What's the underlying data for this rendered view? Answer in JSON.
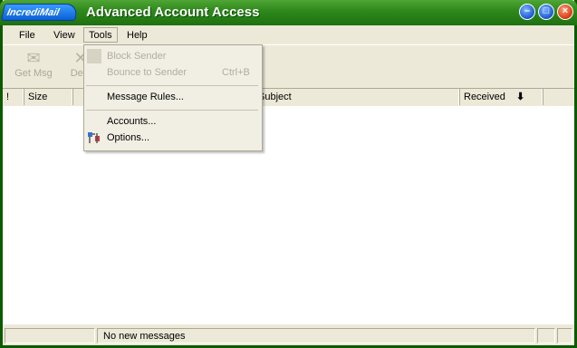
{
  "window": {
    "logo": "IncrediMail",
    "title": "Advanced Account Access",
    "buttons": [
      "minimize",
      "maximize",
      "close"
    ]
  },
  "menubar": [
    {
      "label": "File"
    },
    {
      "label": "View"
    },
    {
      "label": "Tools"
    },
    {
      "label": "Help"
    }
  ],
  "toolbar": {
    "get_msg": "Get Msg",
    "delete": "Dele"
  },
  "columns": {
    "priority": "!",
    "size": "Size",
    "subject": "Subject",
    "received": "Received"
  },
  "tools_menu": {
    "block_sender": "Block Sender",
    "bounce_to_sender": "Bounce to Sender",
    "bounce_shortcut": "Ctrl+B",
    "message_rules": "Message Rules...",
    "accounts": "Accounts...",
    "options": "Options..."
  },
  "status": {
    "message": "No new messages"
  },
  "colors": {
    "titlebar": "#2f8a1c",
    "face": "#ece9d8",
    "menu_bg": "#f1efe4"
  }
}
